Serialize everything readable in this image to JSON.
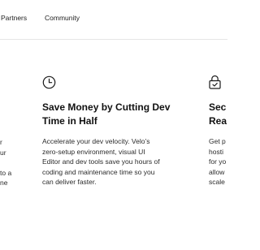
{
  "nav": {
    "items": [
      "Partners",
      "Community"
    ]
  },
  "cards": {
    "left_fragment": {
      "lines": [
        "r",
        "ur",
        "",
        "to a",
        "ne"
      ]
    },
    "center": {
      "icon": "clock-icon",
      "title_lines": [
        "Save Money by Cutting Dev",
        "Time in Half"
      ],
      "desc_lines": [
        "Accelerate your dev velocity. Velo’s",
        "zero-setup environment, visual UI",
        "Editor and dev tools save you hours of",
        "coding and maintenance time so you",
        "can deliver faster."
      ]
    },
    "right_fragment": {
      "icon": "lock-icon",
      "title_lines": [
        "Sec",
        "Rea"
      ],
      "desc_lines": [
        "Get p",
        "hosti",
        "for yo",
        "allow",
        "scale"
      ]
    }
  },
  "colors": {
    "text": "#1a1a1a",
    "divider": "#e6e6e6",
    "background": "#ffffff"
  }
}
